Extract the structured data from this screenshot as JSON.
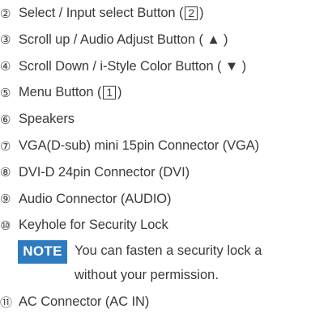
{
  "items": [
    {
      "num": "②",
      "pre": "Select / Input select Button (",
      "box": "2",
      "post": ")"
    },
    {
      "num": "③",
      "text": "Scroll up / Audio Adjust Button ( ▲ )"
    },
    {
      "num": "④",
      "text": "Scroll Down / i-Style Color Button ( ▼ )"
    },
    {
      "num": "⑤",
      "pre": "Menu Button (",
      "box": "1",
      "post": ")"
    },
    {
      "num": "⑥",
      "text": "Speakers"
    },
    {
      "num": "⑦",
      "text": "VGA(D-sub) mini 15pin Connector (VGA)"
    },
    {
      "num": "⑧",
      "text": "DVI-D 24pin Connector (DVI)"
    },
    {
      "num": "⑨",
      "text": "Audio Connector (AUDIO)"
    },
    {
      "num": "⑩",
      "text": "Keyhole for Security Lock"
    },
    {
      "num": "⑪",
      "text": "AC Connector (AC IN)"
    }
  ],
  "note": {
    "label": "NOTE",
    "line1": "You can fasten a security lock a",
    "line2": "without your permission."
  },
  "colors": {
    "note_badge": "#2e7bbf",
    "text": "#3a3a3a"
  }
}
